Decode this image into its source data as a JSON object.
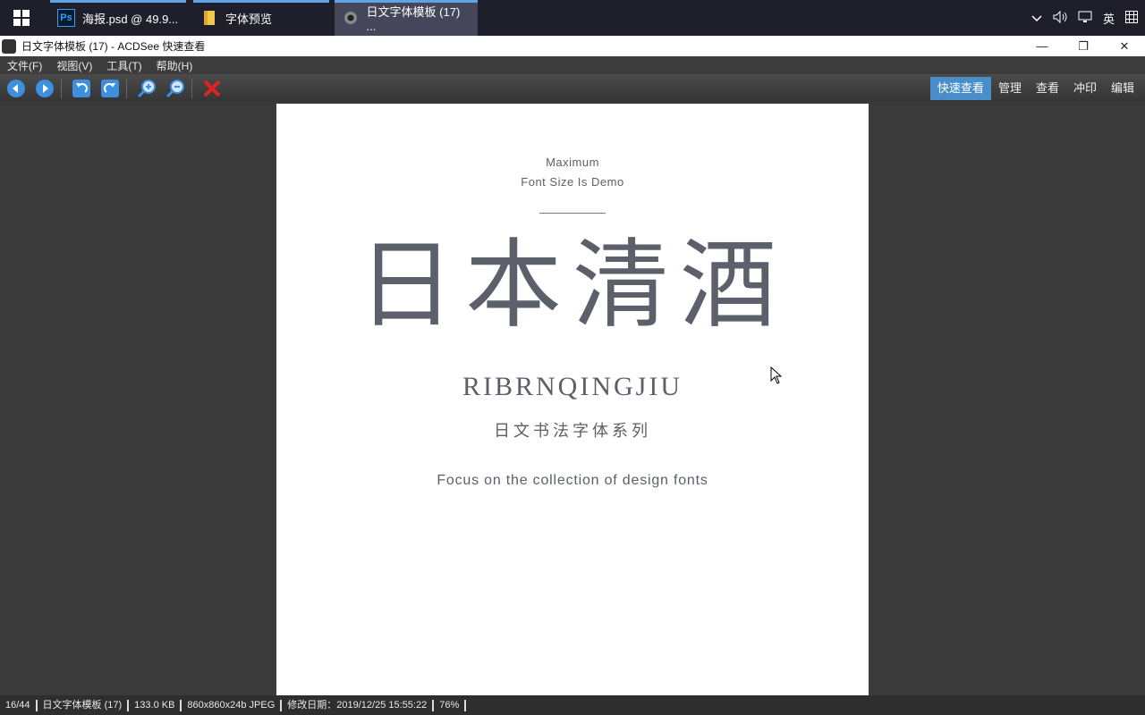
{
  "taskbar": {
    "tasks": [
      {
        "label": "海报.psd @ 49.9...",
        "icon": "photoshop-icon"
      },
      {
        "label": "字体预览",
        "icon": "folder-icon"
      },
      {
        "label": "日文字体模板 (17) ...",
        "icon": "acdsee-icon"
      }
    ],
    "tray": {
      "ime": "英"
    }
  },
  "window": {
    "title": "日文字体模板 (17) - ACDSee 快速查看"
  },
  "menu": [
    "文件(F)",
    "视图(V)",
    "工具(T)",
    "帮助(H)"
  ],
  "modes": [
    "快速查看",
    "管理",
    "查看",
    "冲印",
    "编辑"
  ],
  "poster": {
    "line1": "Maximum",
    "line2": "Font Size Is Demo",
    "title": "日本清酒",
    "romanized": "RIBRNQINGJIU",
    "subtitle": "日文书法字体系列",
    "tagline": "Focus on the collection of design fonts"
  },
  "status": {
    "index": "16/44",
    "filename": "日文字体模板 (17)",
    "filesize": "133.0 KB",
    "dimensions": "860x860x24b JPEG",
    "modified": "修改日期：2019/12/25 15:55:22",
    "zoom": "76%"
  },
  "colors": {
    "accent": "#4a8ec9",
    "taskbar": "#1f1f2b"
  }
}
